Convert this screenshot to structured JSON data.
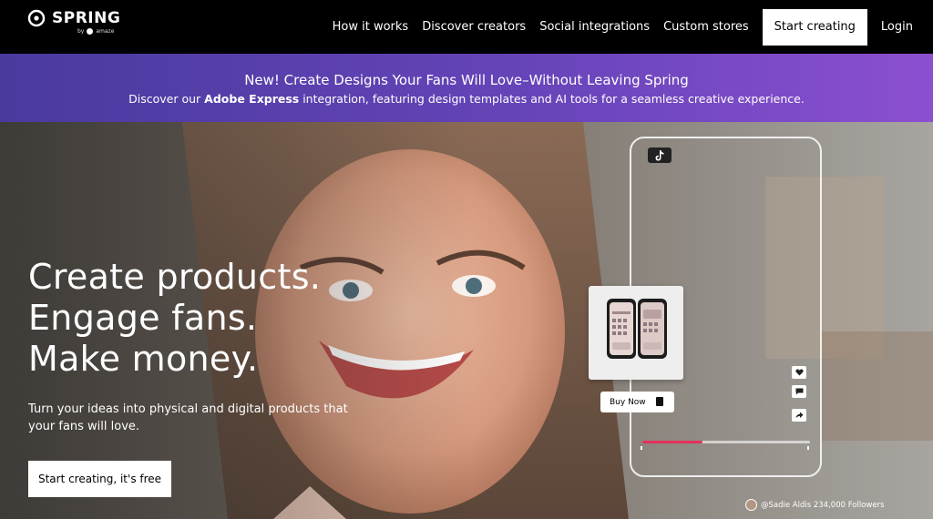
{
  "nav": {
    "logo_word": "SPRING",
    "logo_by": "by",
    "logo_brand": "amaze",
    "links": [
      "How it works",
      "Discover creators",
      "Social integrations",
      "Custom stores"
    ],
    "cta": "Start creating",
    "login": "Login"
  },
  "banner": {
    "title": "New! Create Designs Your Fans Will Love–Without Leaving Spring",
    "sub_prefix": "Discover our ",
    "sub_bold": "Adobe Express",
    "sub_suffix": " integration, featuring design templates and AI tools for a seamless creative experience.",
    "gradient_start": "#4a3a9e",
    "gradient_end": "#8b4fd0"
  },
  "hero": {
    "headline": [
      "Create products.",
      "Engage fans.",
      "Make money."
    ],
    "subtext": "Turn your ideas into physical and digital products that your fans will love.",
    "cta": "Start creating, it's free",
    "buy_now": "Buy Now",
    "credit": "@Sadie Aldis 234,000 Followers",
    "video_progress": 0.36,
    "progress_color": "#e2325a",
    "icons": [
      "tiktok-icon",
      "heart-icon",
      "comment-icon",
      "share-icon",
      "shopping-bag-icon"
    ]
  }
}
